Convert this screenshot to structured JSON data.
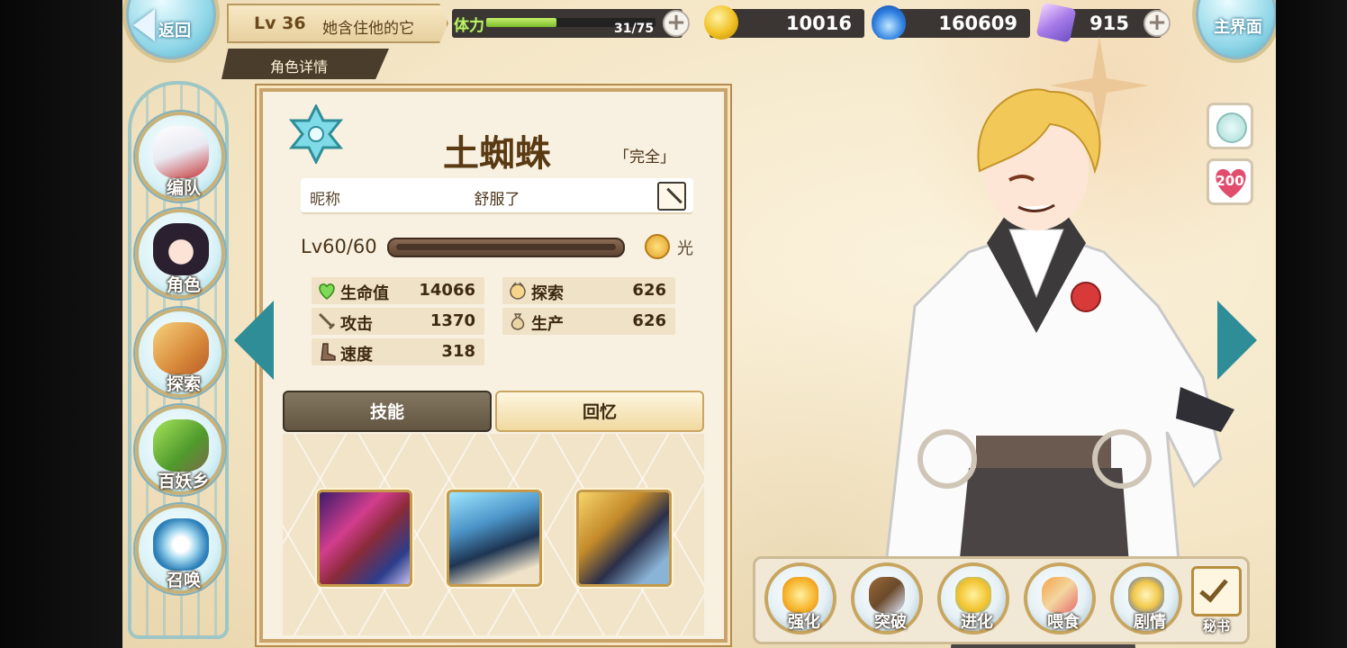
{
  "header": {
    "back_label": "返回",
    "home_label": "主界面",
    "level": "Lv 36",
    "player_name": "她含住他的它",
    "section_tab": "角色详情",
    "stamina": {
      "label": "体力",
      "text": "31/75",
      "current": 31,
      "max": 75
    },
    "gold": "10016",
    "spirit": "160609",
    "crystal": "915"
  },
  "sidebar": {
    "items": [
      {
        "label": "编队",
        "icon": "team-icon"
      },
      {
        "label": "角色",
        "icon": "character-icon"
      },
      {
        "label": "探索",
        "icon": "explore-icon"
      },
      {
        "label": "百妖乡",
        "icon": "village-icon"
      },
      {
        "label": "召唤",
        "icon": "summon-icon"
      }
    ]
  },
  "card": {
    "name": "土蜘蛛",
    "status": "「完全」",
    "nickname_label": "昵称",
    "nickname": "舒服了",
    "level_text": "Lv60/60",
    "level_fraction": 1.0,
    "attribute": "光",
    "stats": {
      "hp": {
        "label": "生命值",
        "value": "14066"
      },
      "attack": {
        "label": "攻击",
        "value": "1370"
      },
      "speed": {
        "label": "速度",
        "value": "318"
      },
      "explore": {
        "label": "探索",
        "value": "626"
      },
      "produce": {
        "label": "生产",
        "value": "626"
      }
    },
    "tabs": {
      "skills": "技能",
      "memory": "回忆"
    }
  },
  "right_icons": {
    "affection": "200"
  },
  "actions": [
    {
      "label": "强化",
      "icon": "enhance-icon"
    },
    {
      "label": "突破",
      "icon": "breakthrough-icon"
    },
    {
      "label": "进化",
      "icon": "evolve-icon"
    },
    {
      "label": "喂食",
      "icon": "feed-icon"
    },
    {
      "label": "剧情",
      "icon": "story-icon"
    }
  ],
  "secretary_label": "秘书",
  "colors": {
    "accent_teal": "#2f8d97",
    "gold_trim": "#c9a36a",
    "stamina_green": "#7bbd2c"
  }
}
